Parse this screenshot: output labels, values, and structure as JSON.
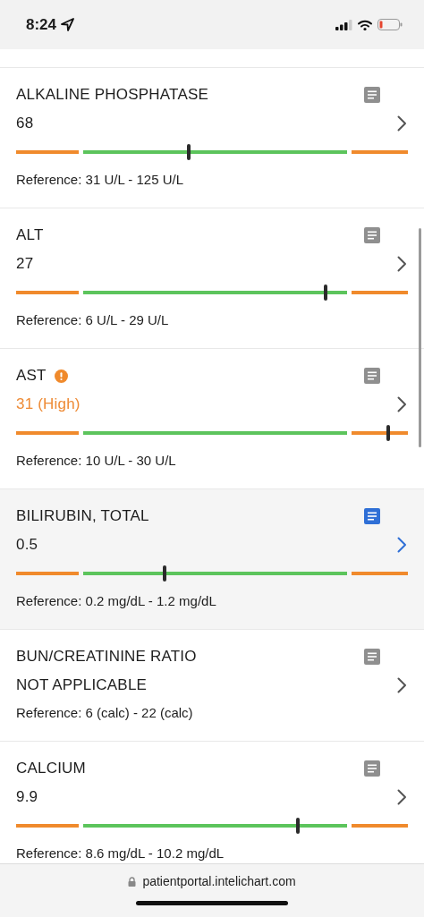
{
  "status_bar": {
    "time": "8:24"
  },
  "results": [
    {
      "name": "ALKALINE PHOSPHATASE",
      "value": "68",
      "flagged": false,
      "selected": false,
      "level": 0.44,
      "reference": "Reference: 31 U/L - 125 U/L"
    },
    {
      "name": "ALT",
      "value": "27",
      "flagged": false,
      "selected": false,
      "level": 0.79,
      "reference": "Reference: 6 U/L - 29 U/L"
    },
    {
      "name": "AST",
      "value": "31 (High)",
      "flagged": true,
      "selected": false,
      "level": 0.95,
      "reference": "Reference: 10 U/L - 30 U/L"
    },
    {
      "name": "BILIRUBIN, TOTAL",
      "value": "0.5",
      "flagged": false,
      "selected": true,
      "level": 0.38,
      "reference": "Reference: 0.2 mg/dL - 1.2 mg/dL"
    },
    {
      "name": "BUN/CREATININE RATIO",
      "value": "NOT APPLICABLE",
      "flagged": false,
      "selected": false,
      "reference": "Reference: 6 (calc) - 22 (calc)"
    },
    {
      "name": "CALCIUM",
      "value": "9.9",
      "flagged": false,
      "selected": false,
      "level": 0.72,
      "reference": "Reference: 8.6 mg/dL - 10.2 mg/dL"
    }
  ],
  "browser_bar": {
    "url": "patientportal.intelichart.com"
  }
}
